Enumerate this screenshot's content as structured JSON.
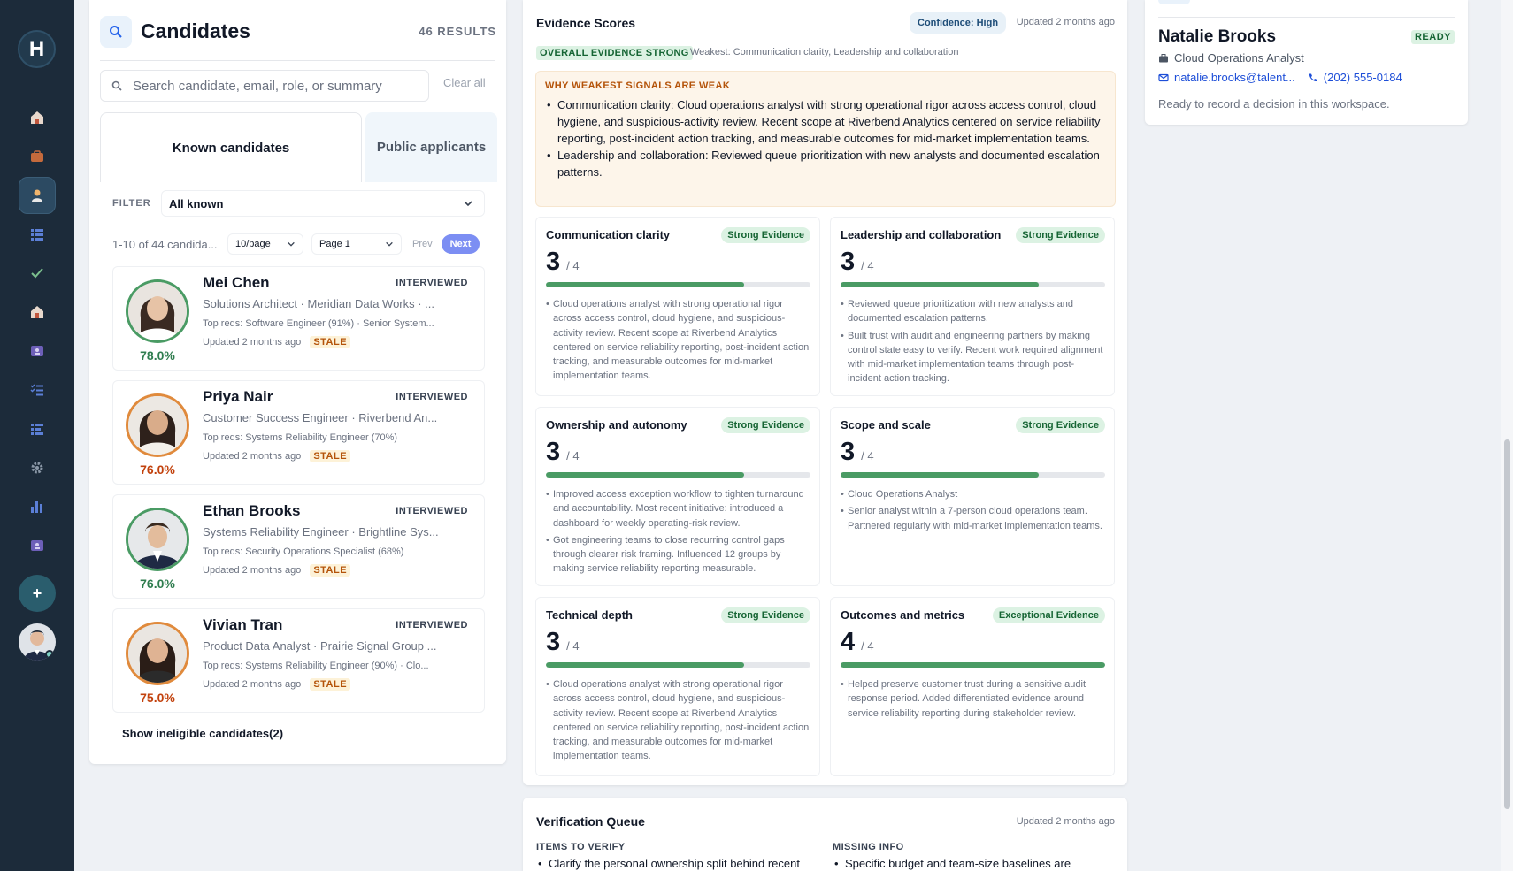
{
  "rail": {
    "logo": "H",
    "icons": [
      "home-icon",
      "briefcase-icon",
      "person-icon",
      "list-icon",
      "check-icon",
      "building-icon",
      "id-card-icon",
      "checklist-icon",
      "list-alt-icon",
      "gear-icon",
      "bar-chart-icon",
      "contact-card-icon"
    ],
    "add_label": "+"
  },
  "candidates": {
    "title": "Candidates",
    "results": "46 RESULTS",
    "search_placeholder": "Search candidate, email, role, or summary",
    "clear_all": "Clear all",
    "tabs": [
      "Known candidates",
      "Public applicants"
    ],
    "filter_label": "FILTER",
    "filter_value": "All known",
    "range": "1-10 of 44 candida...",
    "per_page": "10/page",
    "page": "Page 1",
    "prev": "Prev",
    "next": "Next",
    "items": [
      {
        "name": "Mei Chen",
        "status": "INTERVIEWED",
        "role": "Solutions Architect · Meridian Data Works · ...",
        "reqs": "Top reqs: Software Engineer (91%) · Senior System...",
        "updated": "Updated 2 months ago",
        "stale": "STALE",
        "score": "78.0%",
        "score_color": "#2f7d4f",
        "ring_color": "#4a9b64"
      },
      {
        "name": "Priya Nair",
        "status": "INTERVIEWED",
        "role": "Customer Success Engineer · Riverbend An...",
        "reqs": "Top reqs: Systems Reliability Engineer (70%)",
        "updated": "Updated 2 months ago",
        "stale": "STALE",
        "score": "76.0%",
        "score_color": "#c2410c",
        "ring_color": "#e08a3c"
      },
      {
        "name": "Ethan Brooks",
        "status": "INTERVIEWED",
        "role": "Systems Reliability Engineer · Brightline Sys...",
        "reqs": "Top reqs: Security Operations Specialist (68%)",
        "updated": "Updated 2 months ago",
        "stale": "STALE",
        "score": "76.0%",
        "score_color": "#2f7d4f",
        "ring_color": "#4a9b64"
      },
      {
        "name": "Vivian Tran",
        "status": "INTERVIEWED",
        "role": "Product Data Analyst · Prairie Signal Group ...",
        "reqs": "Top reqs: Systems Reliability Engineer (90%) · Clo...",
        "updated": "Updated 2 months ago",
        "stale": "STALE",
        "score": "75.0%",
        "score_color": "#c2410c",
        "ring_color": "#e08a3c"
      }
    ],
    "show_ineligible": "Show ineligible candidates(2)"
  },
  "evidence": {
    "title": "Evidence Scores",
    "confidence": "Confidence: High",
    "updated": "Updated 2 months ago",
    "overall": "OVERALL EVIDENCE STRONG",
    "weakest": "Weakest: Communication clarity, Leadership and collaboration",
    "why_title": "WHY WEAKEST SIGNALS ARE WEAK",
    "why_items": [
      "Communication clarity: Cloud operations analyst with strong operational rigor across access control, cloud hygiene, and suspicious-activity review. Recent scope at Riverbend Analytics centered on service reliability reporting, post-incident action tracking, and measurable outcomes for mid-market implementation teams.",
      "Leadership and collaboration: Reviewed queue prioritization with new analysts and documented escalation patterns."
    ],
    "cards": [
      {
        "title": "Communication clarity",
        "badge": "Strong Evidence",
        "score": "3",
        "max": "/ 4",
        "fraction": 0.75,
        "bullets": [
          "Cloud operations analyst with strong operational rigor across access control, cloud hygiene, and suspicious-activity review. Recent scope at Riverbend Analytics centered on service reliability reporting, post-incident action tracking, and measurable outcomes for mid-market implementation teams."
        ]
      },
      {
        "title": "Leadership and collaboration",
        "badge": "Strong Evidence",
        "score": "3",
        "max": "/ 4",
        "fraction": 0.75,
        "bullets": [
          "Reviewed queue prioritization with new analysts and documented escalation patterns.",
          "Built trust with audit and engineering partners by making control state easy to verify. Recent work required alignment with mid-market implementation teams through post-incident action tracking."
        ]
      },
      {
        "title": "Ownership and autonomy",
        "badge": "Strong Evidence",
        "score": "3",
        "max": "/ 4",
        "fraction": 0.75,
        "bullets": [
          "Improved access exception workflow to tighten turnaround and accountability. Most recent initiative: introduced a dashboard for weekly operating-risk review.",
          "Got engineering teams to close recurring control gaps through clearer risk framing. Influenced 12 groups by making service reliability reporting measurable."
        ]
      },
      {
        "title": "Scope and scale",
        "badge": "Strong Evidence",
        "score": "3",
        "max": "/ 4",
        "fraction": 0.75,
        "bullets": [
          "Cloud Operations Analyst",
          "Senior analyst within a 7-person cloud operations team. Partnered regularly with mid-market implementation teams."
        ]
      },
      {
        "title": "Technical depth",
        "badge": "Strong Evidence",
        "score": "3",
        "max": "/ 4",
        "fraction": 0.75,
        "bullets": [
          "Cloud operations analyst with strong operational rigor across access control, cloud hygiene, and suspicious-activity review. Recent scope at Riverbend Analytics centered on service reliability reporting, post-incident action tracking, and measurable outcomes for mid-market implementation teams."
        ]
      },
      {
        "title": "Outcomes and metrics",
        "badge": "Exceptional Evidence",
        "score": "4",
        "max": "/ 4",
        "fraction": 1.0,
        "bullets": [
          "Helped preserve customer trust during a sensitive audit response period. Added differentiated evidence around service reliability reporting during stakeholder review."
        ]
      }
    ]
  },
  "verification": {
    "title": "Verification Queue",
    "updated": "Updated 2 months ago",
    "items_header": "ITEMS TO VERIFY",
    "items_first": "Clarify the personal ownership split behind recent",
    "missing_header": "MISSING INFO",
    "missing_first": "Specific budget and team-size baselines are"
  },
  "profile": {
    "name": "Natalie Brooks",
    "status": "READY",
    "role": "Cloud Operations Analyst",
    "email": "natalie.brooks@talent...",
    "phone": "(202) 555-0184",
    "note": "Ready to record a decision in this workspace."
  },
  "colors": {
    "rail_bg": "#1c2b3a",
    "accent": "#7c8ef3",
    "evidence_green": "#4a9b64",
    "stale_orange": "#b45309"
  }
}
